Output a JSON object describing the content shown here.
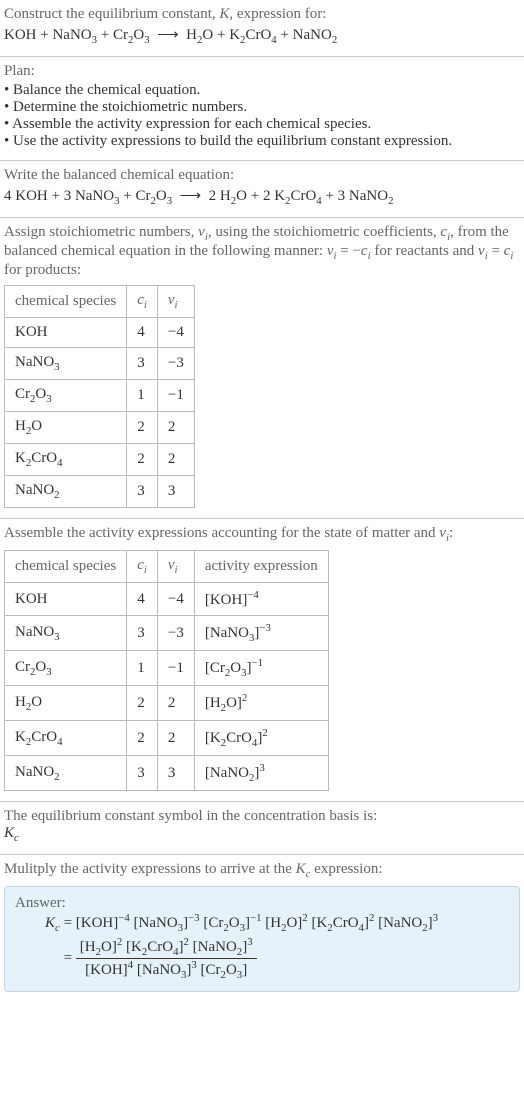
{
  "header": {
    "prompt": "Construct the equilibrium constant, K, expression for:",
    "equation": "KOH + NaNO₃ + Cr₂O₃ ⟶ H₂O + K₂CrO₄ + NaNO₂"
  },
  "plan": {
    "title": "Plan:",
    "items": [
      "• Balance the chemical equation.",
      "• Determine the stoichiometric numbers.",
      "• Assemble the activity expression for each chemical species.",
      "• Use the activity expressions to build the equilibrium constant expression."
    ]
  },
  "balanced": {
    "prompt": "Write the balanced chemical equation:",
    "equation": "4 KOH + 3 NaNO₃ + Cr₂O₃ ⟶ 2 H₂O + 2 K₂CrO₄ + 3 NaNO₂"
  },
  "stoich": {
    "prompt_line1": "Assign stoichiometric numbers, νᵢ, using the stoichiometric coefficients, cᵢ, from the balanced chemical equation in the following manner: νᵢ = −cᵢ for reactants and νᵢ = cᵢ for products:",
    "headers": {
      "species": "chemical species",
      "c": "cᵢ",
      "v": "νᵢ"
    },
    "rows": [
      {
        "sp": "KOH",
        "c": "4",
        "v": "−4"
      },
      {
        "sp": "NaNO₃",
        "c": "3",
        "v": "−3"
      },
      {
        "sp": "Cr₂O₃",
        "c": "1",
        "v": "−1"
      },
      {
        "sp": "H₂O",
        "c": "2",
        "v": "2"
      },
      {
        "sp": "K₂CrO₄",
        "c": "2",
        "v": "2"
      },
      {
        "sp": "NaNO₂",
        "c": "3",
        "v": "3"
      }
    ]
  },
  "activity": {
    "prompt": "Assemble the activity expressions accounting for the state of matter and νᵢ:",
    "headers": {
      "species": "chemical species",
      "c": "cᵢ",
      "v": "νᵢ",
      "act": "activity expression"
    },
    "rows": [
      {
        "sp": "KOH",
        "c": "4",
        "v": "−4",
        "act": "[KOH]⁻⁴"
      },
      {
        "sp": "NaNO₃",
        "c": "3",
        "v": "−3",
        "act": "[NaNO₃]⁻³"
      },
      {
        "sp": "Cr₂O₃",
        "c": "1",
        "v": "−1",
        "act": "[Cr₂O₃]⁻¹"
      },
      {
        "sp": "H₂O",
        "c": "2",
        "v": "2",
        "act": "[H₂O]²"
      },
      {
        "sp": "K₂CrO₄",
        "c": "2",
        "v": "2",
        "act": "[K₂CrO₄]²"
      },
      {
        "sp": "NaNO₂",
        "c": "3",
        "v": "3",
        "act": "[NaNO₂]³"
      }
    ]
  },
  "kc_symbol": {
    "prompt": "The equilibrium constant symbol in the concentration basis is:",
    "value": "K_c"
  },
  "final": {
    "prompt": "Mulitply the activity expressions to arrive at the K_c expression:",
    "answer_label": "Answer:",
    "line1": "K_c = [KOH]⁻⁴ [NaNO₃]⁻³ [Cr₂O₃]⁻¹ [H₂O]² [K₂CrO₄]² [NaNO₂]³",
    "frac_num": "[H₂O]² [K₂CrO₄]² [NaNO₂]³",
    "frac_den": "[KOH]⁴ [NaNO₃]³ [Cr₂O₃]",
    "equals": "= "
  }
}
